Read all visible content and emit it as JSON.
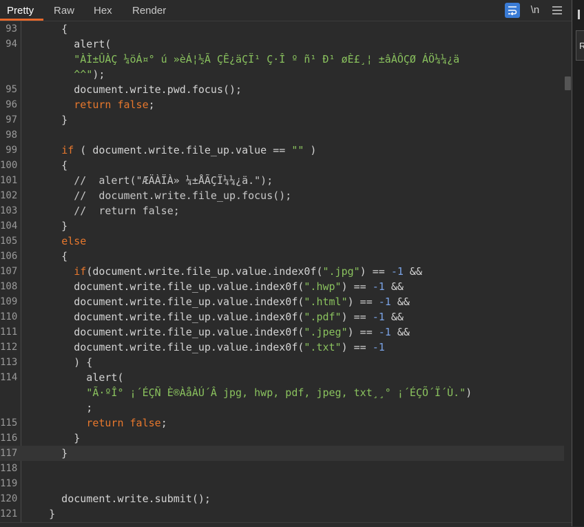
{
  "tabs": [
    {
      "label": "Pretty",
      "active": true
    },
    {
      "label": "Raw",
      "active": false
    },
    {
      "label": "Hex",
      "active": false
    },
    {
      "label": "Render",
      "active": false
    }
  ],
  "toolbar": {
    "wrap_icon": "word-wrap-icon",
    "newline_label": "\\n",
    "menu_icon": "hamburger-menu-icon",
    "accent_color": "#3a7bd5"
  },
  "colors": {
    "keyword": "#e8782d",
    "string": "#8ac25e",
    "number": "#7aa3e6",
    "active_tab_underline": "#e8692c"
  },
  "side_panel": {
    "letter": "R"
  },
  "lines": [
    {
      "n": "93",
      "segs": [
        {
          "t": "      {",
          "c": ""
        }
      ]
    },
    {
      "n": "94",
      "segs": [
        {
          "t": "        alert(",
          "c": ""
        }
      ]
    },
    {
      "n": "",
      "segs": [
        {
          "t": "        \"ÀÌ±ÛÀÇ ¼öÁ¤° ú »èÁ¦½Ã ÇÊ¿äÇÏ¹ Ç·Î º ñ¹ Ð¹ øÈ£¸¦ ±âÀÔÇØ ÁÖ¼¼¿ä",
          "c": "str"
        }
      ]
    },
    {
      "n": "",
      "segs": [
        {
          "t": "        ^^\"",
          "c": "str"
        },
        {
          "t": ");",
          "c": ""
        }
      ]
    },
    {
      "n": "95",
      "segs": [
        {
          "t": "        document.write.pwd.focus();",
          "c": ""
        }
      ]
    },
    {
      "n": "96",
      "segs": [
        {
          "t": "        ",
          "c": ""
        },
        {
          "t": "return false",
          "c": "kw"
        },
        {
          "t": ";",
          "c": ""
        }
      ]
    },
    {
      "n": "97",
      "segs": [
        {
          "t": "      }",
          "c": ""
        }
      ]
    },
    {
      "n": "98",
      "segs": [
        {
          "t": "",
          "c": ""
        }
      ]
    },
    {
      "n": "99",
      "segs": [
        {
          "t": "      ",
          "c": ""
        },
        {
          "t": "if",
          "c": "kw"
        },
        {
          "t": " ( document.write.file_up.value == ",
          "c": ""
        },
        {
          "t": "\"\"",
          "c": "str"
        },
        {
          "t": " )",
          "c": ""
        }
      ]
    },
    {
      "n": "100",
      "segs": [
        {
          "t": "      {",
          "c": ""
        }
      ]
    },
    {
      "n": "101",
      "segs": [
        {
          "t": "        //  alert(\"ÆÄÀÏÀ» ¼±ÅÃÇÏ¼¼¿ä.\");",
          "c": "cm"
        }
      ]
    },
    {
      "n": "102",
      "segs": [
        {
          "t": "        //  document.write.file_up.focus();",
          "c": "cm"
        }
      ]
    },
    {
      "n": "103",
      "segs": [
        {
          "t": "        //  return false;",
          "c": "cm"
        }
      ]
    },
    {
      "n": "104",
      "segs": [
        {
          "t": "      }",
          "c": ""
        }
      ]
    },
    {
      "n": "105",
      "segs": [
        {
          "t": "      ",
          "c": ""
        },
        {
          "t": "else",
          "c": "kw"
        }
      ]
    },
    {
      "n": "106",
      "segs": [
        {
          "t": "      {",
          "c": ""
        }
      ]
    },
    {
      "n": "107",
      "segs": [
        {
          "t": "        ",
          "c": ""
        },
        {
          "t": "if",
          "c": "kw"
        },
        {
          "t": "(document.write.file_up.value.index0f(",
          "c": ""
        },
        {
          "t": "\".jpg\"",
          "c": "str"
        },
        {
          "t": ") == ",
          "c": ""
        },
        {
          "t": "-1",
          "c": "num"
        },
        {
          "t": " &&",
          "c": ""
        }
      ]
    },
    {
      "n": "108",
      "segs": [
        {
          "t": "        document.write.file_up.value.index0f(",
          "c": ""
        },
        {
          "t": "\".hwp\"",
          "c": "str"
        },
        {
          "t": ") == ",
          "c": ""
        },
        {
          "t": "-1",
          "c": "num"
        },
        {
          "t": " &&",
          "c": ""
        }
      ]
    },
    {
      "n": "109",
      "segs": [
        {
          "t": "        document.write.file_up.value.index0f(",
          "c": ""
        },
        {
          "t": "\".html\"",
          "c": "str"
        },
        {
          "t": ") == ",
          "c": ""
        },
        {
          "t": "-1",
          "c": "num"
        },
        {
          "t": " &&",
          "c": ""
        }
      ]
    },
    {
      "n": "110",
      "segs": [
        {
          "t": "        document.write.file_up.value.index0f(",
          "c": ""
        },
        {
          "t": "\".pdf\"",
          "c": "str"
        },
        {
          "t": ") == ",
          "c": ""
        },
        {
          "t": "-1",
          "c": "num"
        },
        {
          "t": " &&",
          "c": ""
        }
      ]
    },
    {
      "n": "111",
      "segs": [
        {
          "t": "        document.write.file_up.value.index0f(",
          "c": ""
        },
        {
          "t": "\".jpeg\"",
          "c": "str"
        },
        {
          "t": ") == ",
          "c": ""
        },
        {
          "t": "-1",
          "c": "num"
        },
        {
          "t": " &&",
          "c": ""
        }
      ]
    },
    {
      "n": "112",
      "segs": [
        {
          "t": "        document.write.file_up.value.index0f(",
          "c": ""
        },
        {
          "t": "\".txt\"",
          "c": "str"
        },
        {
          "t": ") == ",
          "c": ""
        },
        {
          "t": "-1",
          "c": "num"
        }
      ]
    },
    {
      "n": "113",
      "segs": [
        {
          "t": "        ) {",
          "c": ""
        }
      ]
    },
    {
      "n": "114",
      "segs": [
        {
          "t": "          alert(",
          "c": ""
        }
      ]
    },
    {
      "n": "",
      "segs": [
        {
          "t": "          \"Ã·ºÎ° ¡´ÉÇÑ È®ÀåÀÚ´Â jpg, hwp, pdf, jpeg, txt¸¸° ¡´ÉÇÕ´Ï´Ù.\"",
          "c": "str"
        },
        {
          "t": ")",
          "c": ""
        }
      ]
    },
    {
      "n": "",
      "segs": [
        {
          "t": "          ;",
          "c": ""
        }
      ]
    },
    {
      "n": "115",
      "segs": [
        {
          "t": "          ",
          "c": ""
        },
        {
          "t": "return false",
          "c": "kw"
        },
        {
          "t": ";",
          "c": ""
        }
      ]
    },
    {
      "n": "116",
      "segs": [
        {
          "t": "        }",
          "c": ""
        }
      ]
    },
    {
      "n": "117",
      "segs": [
        {
          "t": "      }",
          "c": ""
        }
      ],
      "highlight": true
    },
    {
      "n": "118",
      "segs": [
        {
          "t": "",
          "c": ""
        }
      ]
    },
    {
      "n": "119",
      "segs": [
        {
          "t": "",
          "c": ""
        }
      ]
    },
    {
      "n": "120",
      "segs": [
        {
          "t": "      document.write.submit();",
          "c": ""
        }
      ]
    },
    {
      "n": "121",
      "segs": [
        {
          "t": "    }",
          "c": ""
        }
      ]
    }
  ]
}
